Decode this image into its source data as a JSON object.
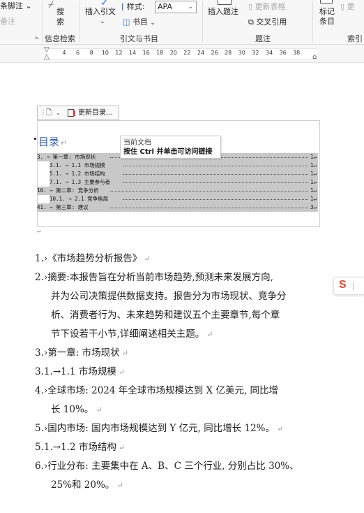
{
  "ribbon": {
    "footnote_label": "条脚注",
    "footnote_chev": "⌄",
    "endnote_label": "备注",
    "search_label_1": "搜",
    "search_label_2": "索",
    "insert_citation": "插入引文",
    "insert_citation_chev": "⌄",
    "style_label": "样式:",
    "style_value": "APA",
    "bibliography_label": "书目",
    "insert_caption": "插入题注",
    "update_table": "更新表格",
    "cross_reference": "交叉引用",
    "mark_entry_1": "标记",
    "mark_entry_2": "条目",
    "update_index_partial": "更",
    "groups": {
      "info_search": "信息检索",
      "citations": "引文与书目",
      "captions": "题注",
      "index": "索引"
    },
    "launcher_icon": "dialog-launcher"
  },
  "ruler": {
    "ticks": [
      "4",
      "6",
      "8",
      "10",
      "12",
      "14",
      "16",
      "18",
      "20",
      "22",
      "24",
      "26",
      "28",
      "30",
      "32",
      "34",
      "36",
      "38"
    ]
  },
  "toc_toolbar": {
    "update_toc": "更新目录..."
  },
  "toc": {
    "title": "目录",
    "return_mark": "↵",
    "entries": [
      {
        "text": "3. → 第一章: 市场现状",
        "page": "1"
      },
      {
        "text": "3.1. → 1.1 市场规模",
        "page": "1"
      },
      {
        "text": "5.1. → 1.2 市场结构",
        "page": "1"
      },
      {
        "text": "7.1. → 1.3 主要参与者",
        "page": "1"
      },
      {
        "text": "10. → 第二章: 竞争分析",
        "page": "1"
      },
      {
        "text": "10.1. → 2.1 竞争格局",
        "page": "1"
      },
      {
        "text": "41. → 第三章: 建议",
        "page": "3"
      }
    ]
  },
  "tooltip": {
    "line1": "当前文档",
    "line2": "按住 Ctrl 并单击可访问链接"
  },
  "body": {
    "paragraphs": [
      {
        "num": "1.",
        "text": "《市场趋势分析报告》"
      },
      {
        "num": "2.",
        "lines": [
          "摘要:本报告旨在分析当前市场趋势,预测未来发展方向,",
          "并为公司决策提供数据支持。报告分为市场现状、竞争分",
          "析、消费者行为、未来趋势和建议五个主要章节,每个章",
          "节下设若干小节,详细阐述相关主题。"
        ]
      },
      {
        "num": "3.",
        "text": "第一章: 市场现状"
      },
      {
        "num": "3.1.",
        "text": "1.1 市场规模"
      },
      {
        "num": "4.",
        "lines": [
          "全球市场: 2024 年全球市场规模达到 X 亿美元, 同比增",
          "长 10%。"
        ]
      },
      {
        "num": "5.",
        "text": "国内市场: 国内市场规模达到 Y 亿元, 同比增长 12%。"
      },
      {
        "num": "5.1.",
        "text": "1.2 市场结构"
      },
      {
        "num": "6.",
        "lines": [
          "行业分布: 主要集中在 A、B、C 三个行业, 分别占比 30%、",
          "25%和 20%。"
        ]
      }
    ],
    "return_mark": "↵",
    "tab_mark": "›",
    "arrow_mark": "→"
  },
  "side_badge": {
    "letter": "S",
    "accent": "#e8452c"
  },
  "colors": {
    "toc_title": "#2d5aa6",
    "toc_highlight": "#c8c8c8",
    "ribbon_bg": "#f7f7f7"
  }
}
